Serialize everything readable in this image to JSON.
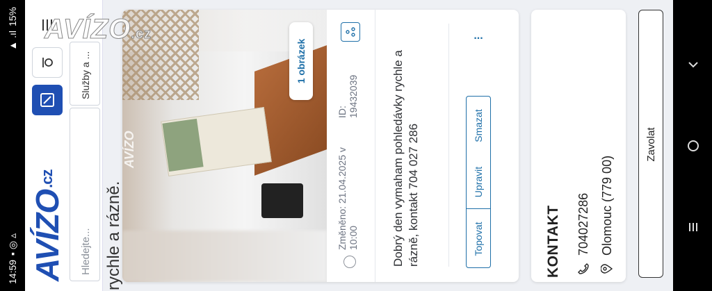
{
  "status_bar": {
    "time": "14:59",
    "battery": "15%"
  },
  "header": {
    "logo": "AVÍZO",
    "logo_tld": ".cz",
    "search_placeholder": "Hledejte...",
    "services_label": "Služby a ..."
  },
  "page_heading": "rychle a rázně.",
  "listing": {
    "image_count_badge": "1 obrázek",
    "photo_watermark": "AVÍZO",
    "id_label": "ID:",
    "id_value": "19432039",
    "modified": "Změněno: 21.04.2025 v 10:00",
    "description": "Dobrý den vymaham pohledávky rychle a rázně, kontakt 704 027 286",
    "actions": [
      "Topovat",
      "Upravit",
      "Smazat"
    ],
    "more_label": "..."
  },
  "contact": {
    "title": "KONTAKT",
    "phone": "704027286",
    "location": "Olomouc (779 00)"
  },
  "call_button": "Zavolat",
  "overlay_brand": "AVÍZO",
  "overlay_tld": ".cz",
  "colors": {
    "brand": "#1f4fb3",
    "accent": "#1e6fa8"
  }
}
